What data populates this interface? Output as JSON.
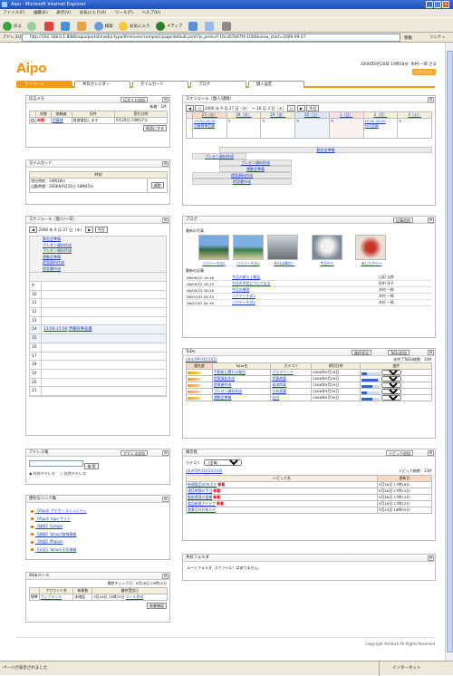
{
  "window": {
    "title": "Aipo - Microsoft Internet Explorer"
  },
  "menu": [
    "ファイル(F)",
    "編集(E)",
    "表示(V)",
    "お気に入り(A)",
    "ツール(T)",
    "ヘルプ(H)"
  ],
  "toolbar": {
    "back": "戻る",
    "search": "検索",
    "favorites": "お気に入り",
    "media": "メディア"
  },
  "address": {
    "label": "アドレス(D)",
    "url": "http://192.168.0.1:8080/aipo/portal/media-type/html/user/sample1/page/default.psml?js_peid=P-10c307b67f4-1000&view_start=2006-09-27",
    "go": "移動",
    "links": "リンク »"
  },
  "status": {
    "text": "ページが表示されました",
    "zone": "インターネット"
  },
  "app": {
    "logo": "Aipo",
    "logo_small": "アイポ",
    "date": "2006年9月28日 19時18分",
    "user": "木村 一郎 さま",
    "logout": "ログアウト"
  },
  "nav": [
    "マイページ",
    "共有カレンダー",
    "タイムカード",
    "ブログ",
    "個人設定"
  ],
  "memo": {
    "title": "伝言メモ",
    "add": "伝言メモ追加",
    "count": "新着：1件",
    "headers": [
      "状態",
      "依頼者",
      "用件",
      "受付日時"
    ],
    "row": {
      "status": "未読",
      "from": "伊藤様",
      "subject": "再度電話します",
      "date": "9月28日 19時17分"
    },
    "list_btn": "既読にする"
  },
  "timecard": {
    "title": "タイムカード",
    "header": "時刻",
    "in": "現在時刻：19時18分",
    "out": "出勤時間：2006年9月21日 18時45分",
    "btn": "退勤"
  },
  "week": {
    "title": "スケジュール（個人/週間）",
    "range": "2006 年 9 月 27 日（水） 〜 10 月 3 日（火）",
    "today": "今日",
    "days": [
      "27（水）",
      "28（木）",
      "29（金）",
      "30（土）",
      "1（日）",
      "2（月）",
      "3（火）"
    ],
    "ev1_time": "13:30-15:00",
    "ev1_name": "伊藤商事会議",
    "ev2_time": "10:00-12:00",
    "ev2_name": "社内会議",
    "bars": [
      "勤怠会準備",
      "プレゼン資料作成",
      "プレゼン資料作成",
      "運動会準備",
      "提案資料作成",
      "提案書作成"
    ]
  },
  "day": {
    "title": "スケジュール（個人/一日）",
    "date": "2006 年 9 月 27 日（水）",
    "today": "今日",
    "items": [
      "勤怠会準備",
      "プレゼン資料作成",
      "プレゼン資料作成",
      "運動会準備",
      "提案資料作成",
      "提案書作成"
    ],
    "hours": [
      "9",
      "10",
      "11",
      "12",
      "13",
      "14",
      "15",
      "16",
      "17",
      "18",
      "19",
      "20",
      "21"
    ],
    "event": "13:00-15:00",
    "event_name": "伊藤商事会議"
  },
  "blog": {
    "title": "ブログ",
    "add": "記事追加",
    "photos_label": "最新の写真",
    "photos": [
      "ハワイ〜その2",
      "ハワイ〜その1",
      "昨日は晴れ！",
      "今日から",
      "あしたから〜"
    ],
    "articles_label": "最新の記事",
    "articles": [
      {
        "date": "06/09/22 18:16",
        "title": "今月の新仕上報告",
        "author": "山田 太郎"
      },
      {
        "date": "06/09/22 18:13",
        "title": "今月の予定についてます",
        "author": "田中 洋子"
      },
      {
        "date": "06/09/22 18:26",
        "title": "今月の練習",
        "author": "木村 一郎"
      },
      {
        "date": "06/07/03 04:33",
        "title": "ハワイ〜その2",
        "author": "木村 一郎"
      },
      {
        "date": "06/07/03 04:30",
        "title": "ハワイ〜その1",
        "author": "木村 一郎"
      }
    ]
  },
  "todo": {
    "title": "ToDo",
    "status_btn": "進捗状況",
    "add": "ToDo追加",
    "pager": "(次の5件)(1)(1)(2)",
    "summary": "未完了ToDo総数：10件",
    "headers": [
      "優先度",
      "ToDo名",
      "カテゴリ",
      "締切日時",
      "進捗"
    ],
    "rows": [
      {
        "name": "手動差に関わる報告",
        "cat": "プライベート",
        "date": "2006年9月28日",
        "pct": "30%"
      },
      {
        "name": "提案資料作成",
        "cat": "伊藤商事",
        "date": "2006年9月28日",
        "pct": "90%"
      },
      {
        "name": "提案書作成",
        "cat": "島津商事",
        "date": "2006年9月29日",
        "pct": "60%"
      },
      {
        "name": "プレゼン資料作成",
        "cat": "分析部課",
        "date": "2006年9月30日",
        "pct": "30%"
      },
      {
        "name": "運動会準備",
        "cat": "社内",
        "date": "2006年9月30日",
        "pct": "60%"
      }
    ]
  },
  "bbs": {
    "title": "掲示板",
    "add": "トピック追加",
    "category_label": "カテゴリ",
    "category": "(全体)",
    "pager": "(次の5件)(1)(1)(2)(3)",
    "summary": "トピック総数：13件",
    "headers": [
      "トピック名",
      "更新日"
    ],
    "rows": [
      {
        "name": "新規製品のPRポイ",
        "new": "新着",
        "date": "9月26日 17時18分"
      },
      {
        "name": "通話時間の手当",
        "new": "新着",
        "date": "9月26日 17時15分"
      },
      {
        "name": "勤務環境の整備",
        "new": "新着",
        "date": "9月26日 17時13分"
      },
      {
        "name": "商品新規アイデア",
        "new": "新着",
        "date": "9月26日 17時12分"
      },
      {
        "name": "就業日のお知らせ",
        "new": "",
        "date": "9月24日 18時05分"
      }
    ]
  },
  "address_book": {
    "title": "アドレス帳",
    "add": "アドレス追加",
    "search": "検 索",
    "opt1": "社外アドレス",
    "opt2": "社内アドレス"
  },
  "links": {
    "title": "便利なリンク集",
    "items": [
      "【Aipo】アイポ・コミュニティ",
      "【Aipo】Aipo サイト",
      "【検索】Google",
      "【路線】Yahoo!路線情報",
      "【地図】Mapion",
      "【天気】Yahoo!天気情報"
    ]
  },
  "webmail": {
    "title": "Webメール",
    "check": "最終チェック日：9月26日 19時15分",
    "headers": [
      "アカウント名",
      "新着数",
      "最終受信日"
    ],
    "row": {
      "tag": "標準",
      "name": "ウェブメール",
      "count": "未確認",
      "date": "9月28日 19時25分",
      "action": "メール作成"
    },
    "btn": "新着確認"
  },
  "folder": {
    "title": "共有フォルダ",
    "text": "ルートフォルダ（1ファイル）はありません。"
  },
  "footer": "Copyright Aimluck All Rights Reserved",
  "colors": {
    "accent": "#f39a1d",
    "link": "#1a44b8",
    "ie_blue": "#1f4fb8"
  }
}
